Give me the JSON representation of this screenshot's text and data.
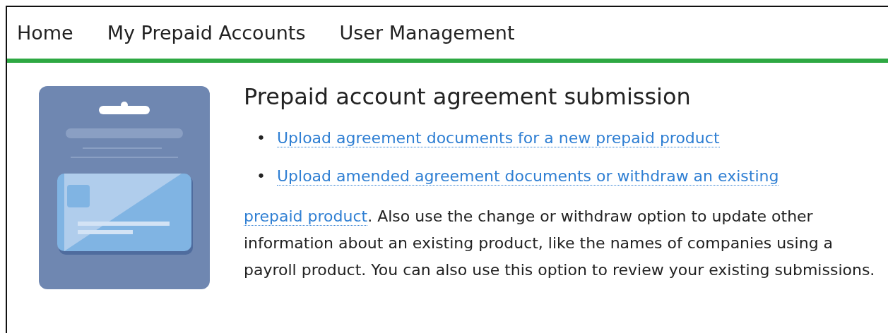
{
  "nav": {
    "items": [
      {
        "label": "Home"
      },
      {
        "label": "My Prepaid Accounts"
      },
      {
        "label": "User Management"
      }
    ]
  },
  "title": "Prepaid account agreement submission",
  "links": [
    {
      "bullet": "•",
      "label": "Upload agreement documents for a new prepaid product"
    },
    {
      "bullet": "•",
      "label": "Upload amended agreement documents or withdraw an existing"
    }
  ],
  "paragraph": {
    "link": "prepaid product",
    "text": ". Also use the change or withdraw option to update other information about an existing product, like the names of companies using a payroll product. You can also use this option to review your existing submissions."
  }
}
